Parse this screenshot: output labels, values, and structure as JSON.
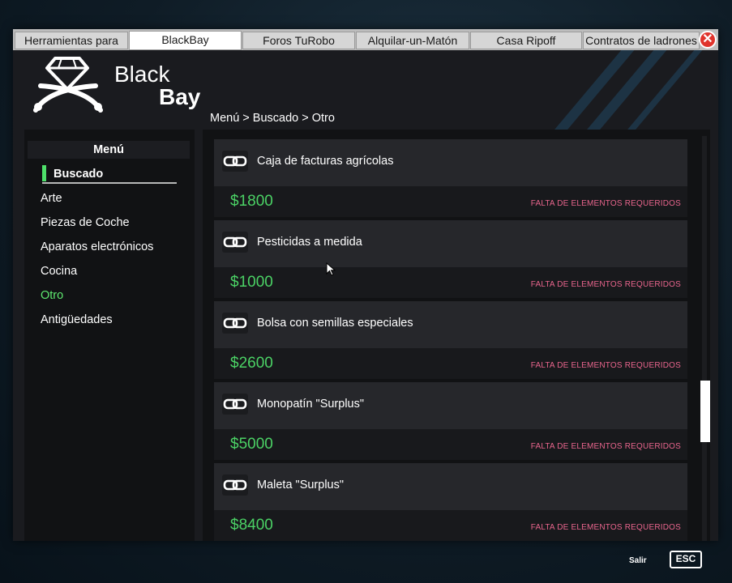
{
  "tabs": [
    {
      "label": "Herramientas para",
      "active": false
    },
    {
      "label": "BlackBay",
      "active": true
    },
    {
      "label": "Foros TuRobo",
      "active": false
    },
    {
      "label": "Alquilar-un-Matón",
      "active": false
    },
    {
      "label": "Casa Ripoff",
      "active": false
    },
    {
      "label": "Contratos de ladrones",
      "active": false
    }
  ],
  "close_glyph": "✕",
  "brand": {
    "line1": "Black",
    "line2": "Bay",
    "logo_icon": "diamond-crossed-swords-icon"
  },
  "breadcrumb": "Menú > Buscado > Otro",
  "sidebar": {
    "title": "Menú",
    "items": [
      {
        "label": "Buscado",
        "state": "selected"
      },
      {
        "label": "Arte",
        "state": "normal"
      },
      {
        "label": "Piezas de Coche",
        "state": "normal"
      },
      {
        "label": "Aparatos electrónicos",
        "state": "normal"
      },
      {
        "label": "Cocina",
        "state": "normal"
      },
      {
        "label": "Otro",
        "state": "current"
      },
      {
        "label": "Antigüedades",
        "state": "normal"
      }
    ]
  },
  "listings": [
    {
      "name": "Caja de facturas agrícolas",
      "price": "$1800",
      "status": "FALTA DE ELEMENTOS REQUERIDOS",
      "icon": "chain-link-icon"
    },
    {
      "name": "Pesticidas a medida",
      "price": "$1000",
      "status": "FALTA DE ELEMENTOS REQUERIDOS",
      "icon": "chain-link-icon"
    },
    {
      "name": "Bolsa con semillas especiales",
      "price": "$2600",
      "status": "FALTA DE ELEMENTOS REQUERIDOS",
      "icon": "chain-link-icon"
    },
    {
      "name": "Monopatín \"Surplus\"",
      "price": "$5000",
      "status": "FALTA DE ELEMENTOS REQUERIDOS",
      "icon": "chain-link-icon"
    },
    {
      "name": "Maleta \"Surplus\"",
      "price": "$8400",
      "status": "FALTA DE ELEMENTOS REQUERIDOS",
      "icon": "chain-link-icon"
    }
  ],
  "footer": {
    "exit_label": "Salir",
    "esc_key": "ESC"
  },
  "colors": {
    "price_green": "#4bd265",
    "status_pink": "#e9658d",
    "accent_green": "#4ee06a",
    "close_red": "#e0342d"
  }
}
